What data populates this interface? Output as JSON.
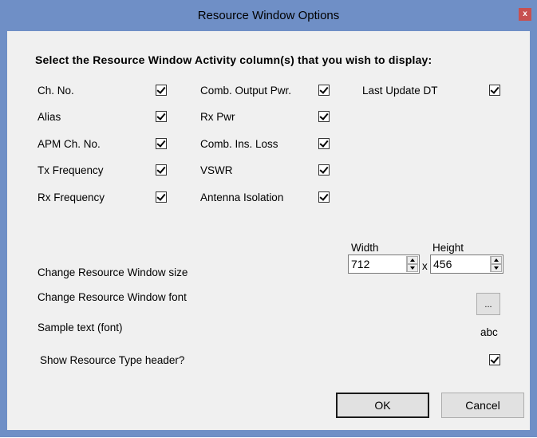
{
  "window": {
    "title": "Resource Window Options",
    "close_label": "x"
  },
  "heading": "Select the Resource Window Activity column(s) that you wish to display:",
  "columns": [
    {
      "label": "Ch. No.",
      "checked": true
    },
    {
      "label": "Alias",
      "checked": true
    },
    {
      "label": "APM Ch. No.",
      "checked": true
    },
    {
      "label": "Tx Frequency",
      "checked": true
    },
    {
      "label": "Rx Frequency",
      "checked": true
    },
    {
      "label": "Comb. Output Pwr.",
      "checked": true
    },
    {
      "label": "Rx Pwr",
      "checked": true
    },
    {
      "label": "Comb. Ins. Loss",
      "checked": true
    },
    {
      "label": "VSWR",
      "checked": true
    },
    {
      "label": "Antenna Isolation",
      "checked": true
    },
    {
      "label": "Last Update DT",
      "checked": true
    }
  ],
  "size": {
    "label": "Change Resource Window size",
    "width_label": "Width",
    "height_label": "Height",
    "width_value": "712",
    "height_value": "456",
    "separator": "x"
  },
  "font": {
    "label": "Change Resource Window font",
    "button_label": "...",
    "sample_label": "Sample text (font)",
    "sample_text": "abc"
  },
  "header_option": {
    "label": "Show Resource Type header?",
    "checked": true
  },
  "buttons": {
    "ok": "OK",
    "cancel": "Cancel"
  },
  "colors": {
    "titlebar": "#6f8fc6",
    "close": "#c75050",
    "client": "#f0f0f0"
  }
}
